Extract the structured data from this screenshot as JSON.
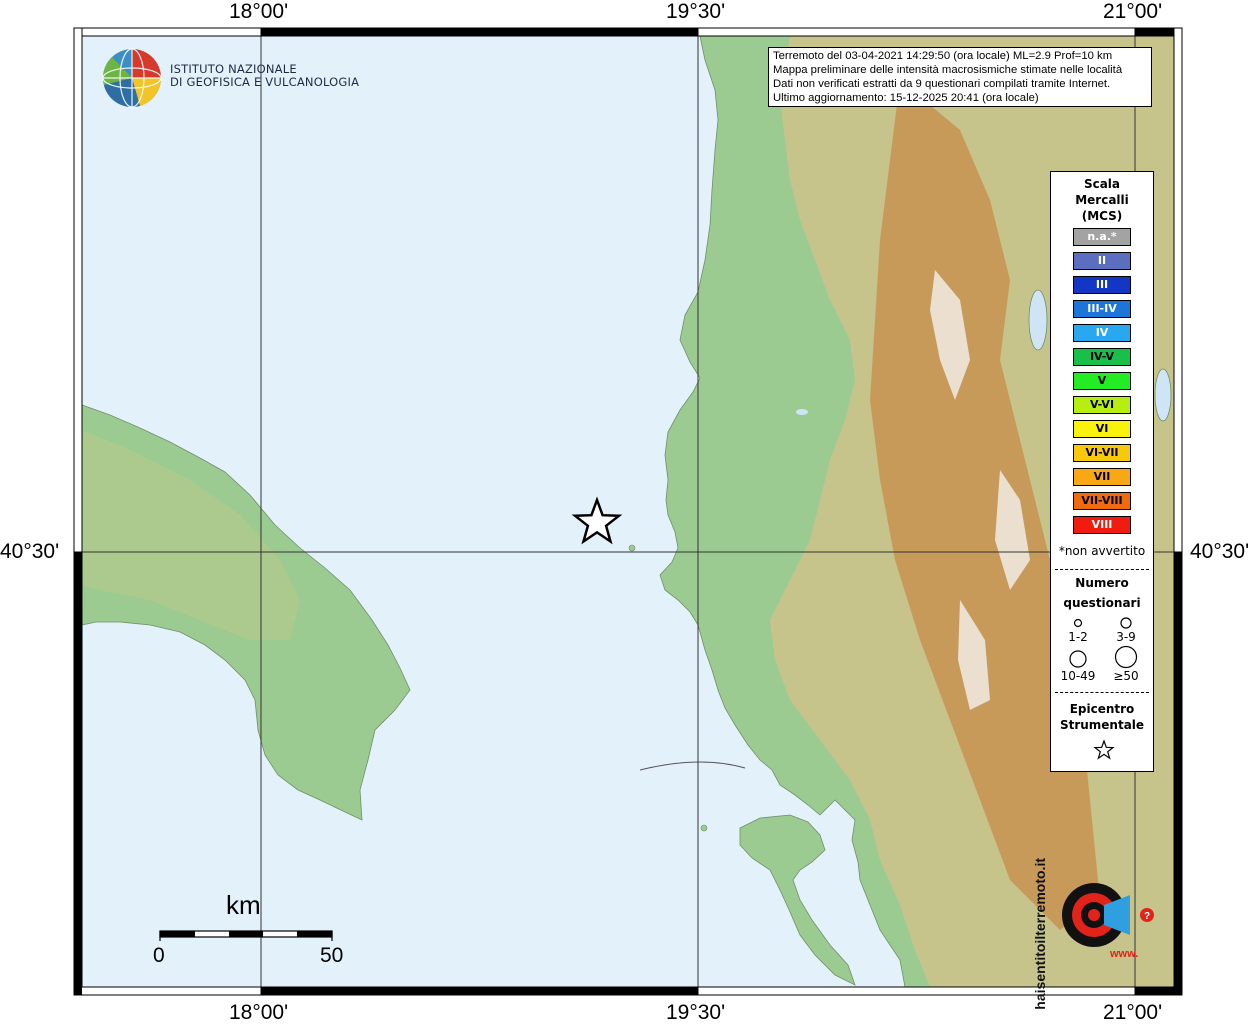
{
  "coords": {
    "top_left": "18°00'",
    "top_mid": "19°30'",
    "top_right": "21°00'",
    "bottom_left": "18°00'",
    "bottom_mid": "19°30'",
    "bottom_right": "21°00'",
    "left_lat": "40°30'",
    "right_lat": "40°30'"
  },
  "logo": {
    "line1": "ISTITUTO NAZIONALE",
    "line2": "DI GEOFISICA E VULCANOLOGIA"
  },
  "info": {
    "line1": "Terremoto del 03-04-2021 14:29:50 (ora locale) ML=2.9 Prof=10 km",
    "line2": "Mappa preliminare delle intensità macrosismiche stimate nelle località",
    "line3": "Dati non verificati estratti da 9 questionari compilati tramite Internet.",
    "line4": "Ultimo aggiornamento: 15-12-2025 20:41 (ora locale)"
  },
  "legend": {
    "title1": "Scala",
    "title2": "Mercalli",
    "title3": "(MCS)",
    "classes": [
      {
        "label": "n.a.*",
        "color": "#a3a3a3",
        "text": "#ffffff"
      },
      {
        "label": "II",
        "color": "#5a6fbf",
        "text": "#ffffff"
      },
      {
        "label": "III",
        "color": "#1436c4",
        "text": "#ffffff"
      },
      {
        "label": "III-IV",
        "color": "#1c76d9",
        "text": "#ffffff"
      },
      {
        "label": "IV",
        "color": "#28a8f0",
        "text": "#ffffff"
      },
      {
        "label": "IV-V",
        "color": "#18c04a",
        "text": "#000000"
      },
      {
        "label": "V",
        "color": "#24ec24",
        "text": "#000000"
      },
      {
        "label": "V-VI",
        "color": "#b6ee10",
        "text": "#000000"
      },
      {
        "label": "VI",
        "color": "#f9f20c",
        "text": "#000000"
      },
      {
        "label": "VI-VII",
        "color": "#f8c80c",
        "text": "#000000"
      },
      {
        "label": "VII",
        "color": "#f8a814",
        "text": "#000000"
      },
      {
        "label": "VII-VIII",
        "color": "#f06a10",
        "text": "#000000"
      },
      {
        "label": "VIII",
        "color": "#f01c10",
        "text": "#ffffff"
      }
    ],
    "not_felt": "*non avvertito",
    "count_title1": "Numero",
    "count_title2": "questionari",
    "counts": [
      "1-2",
      "3-9",
      "10-49",
      "≥50"
    ],
    "epi_title1": "Epicentro",
    "epi_title2": "Strumentale"
  },
  "scale": {
    "unit": "km",
    "zero": "0",
    "max": "50"
  },
  "epicenter": {
    "lon": 19.3,
    "lat": 40.55
  },
  "brand": {
    "ring_text": "haisentitoilterremoto.it",
    "www": "www."
  }
}
